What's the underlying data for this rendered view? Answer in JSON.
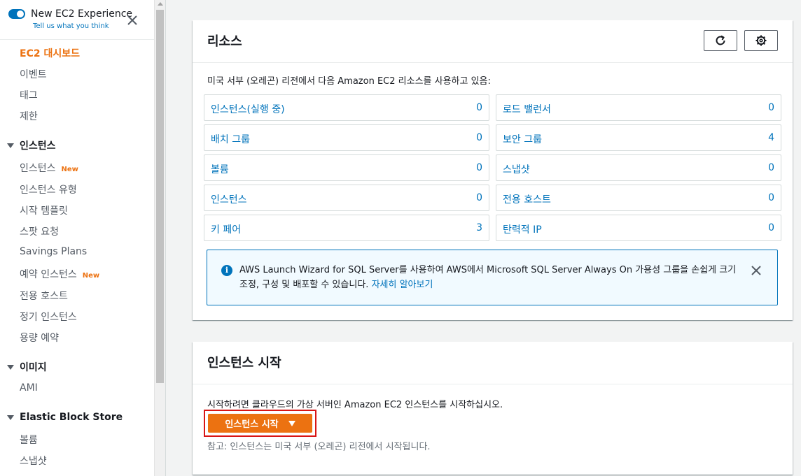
{
  "experience": {
    "title": "New EC2 Experience",
    "link": "Tell us what you think"
  },
  "sidebar": {
    "top_items": [
      {
        "label": "EC2 대시보드",
        "active": true
      },
      {
        "label": "이벤트"
      },
      {
        "label": "태그"
      },
      {
        "label": "제한"
      }
    ],
    "instances_section": "인스턴스",
    "instances_items": [
      {
        "label": "인스턴스",
        "badge": "New"
      },
      {
        "label": "인스턴스 유형"
      },
      {
        "label": "시작 템플릿"
      },
      {
        "label": "스팟 요청"
      },
      {
        "label": "Savings Plans"
      },
      {
        "label": "예약 인스턴스",
        "badge": "New"
      },
      {
        "label": "전용 호스트"
      },
      {
        "label": "정기 인스턴스"
      },
      {
        "label": "용량 예약"
      }
    ],
    "images_section": "이미지",
    "images_items": [
      {
        "label": "AMI"
      }
    ],
    "ebs_section": "Elastic Block Store",
    "ebs_items": [
      {
        "label": "볼륨"
      },
      {
        "label": "스냅샷"
      }
    ]
  },
  "resources": {
    "title": "리소스",
    "refresh_icon": "refresh-icon",
    "settings_icon": "gear-icon",
    "description": "미국 서부 (오레곤) 리전에서 다음 Amazon EC2 리소스를 사용하고 있음:",
    "items": [
      {
        "label": "인스턴스(실행 중)",
        "count": "0"
      },
      {
        "label": "로드 밸런서",
        "count": "0"
      },
      {
        "label": "배치 그룹",
        "count": "0"
      },
      {
        "label": "보안 그룹",
        "count": "4"
      },
      {
        "label": "볼륨",
        "count": "0"
      },
      {
        "label": "스냅샷",
        "count": "0"
      },
      {
        "label": "인스턴스",
        "count": "0"
      },
      {
        "label": "전용 호스트",
        "count": "0"
      },
      {
        "label": "키 페어",
        "count": "3"
      },
      {
        "label": "탄력적 IP",
        "count": "0"
      }
    ],
    "info": {
      "text": "AWS Launch Wizard for SQL Server를 사용하여 AWS에서 Microsoft SQL Server Always On 가용성 그룹을 손쉽게 크기 조정, 구성 및 배포할 수 있습니다.",
      "link": "자세히 알아보기"
    }
  },
  "launch": {
    "title": "인스턴스 시작",
    "description": "시작하려면 클라우드의 가상 서버인 Amazon EC2 인스턴스를 시작하십시오.",
    "button_label": "인스턴스 시작",
    "note": "참고: 인스턴스는 미국 서부 (오레곤) 리전에서 시작됩니다."
  },
  "colors": {
    "accent": "#ec7211",
    "link": "#0073bb",
    "highlight_border": "#d91515"
  }
}
